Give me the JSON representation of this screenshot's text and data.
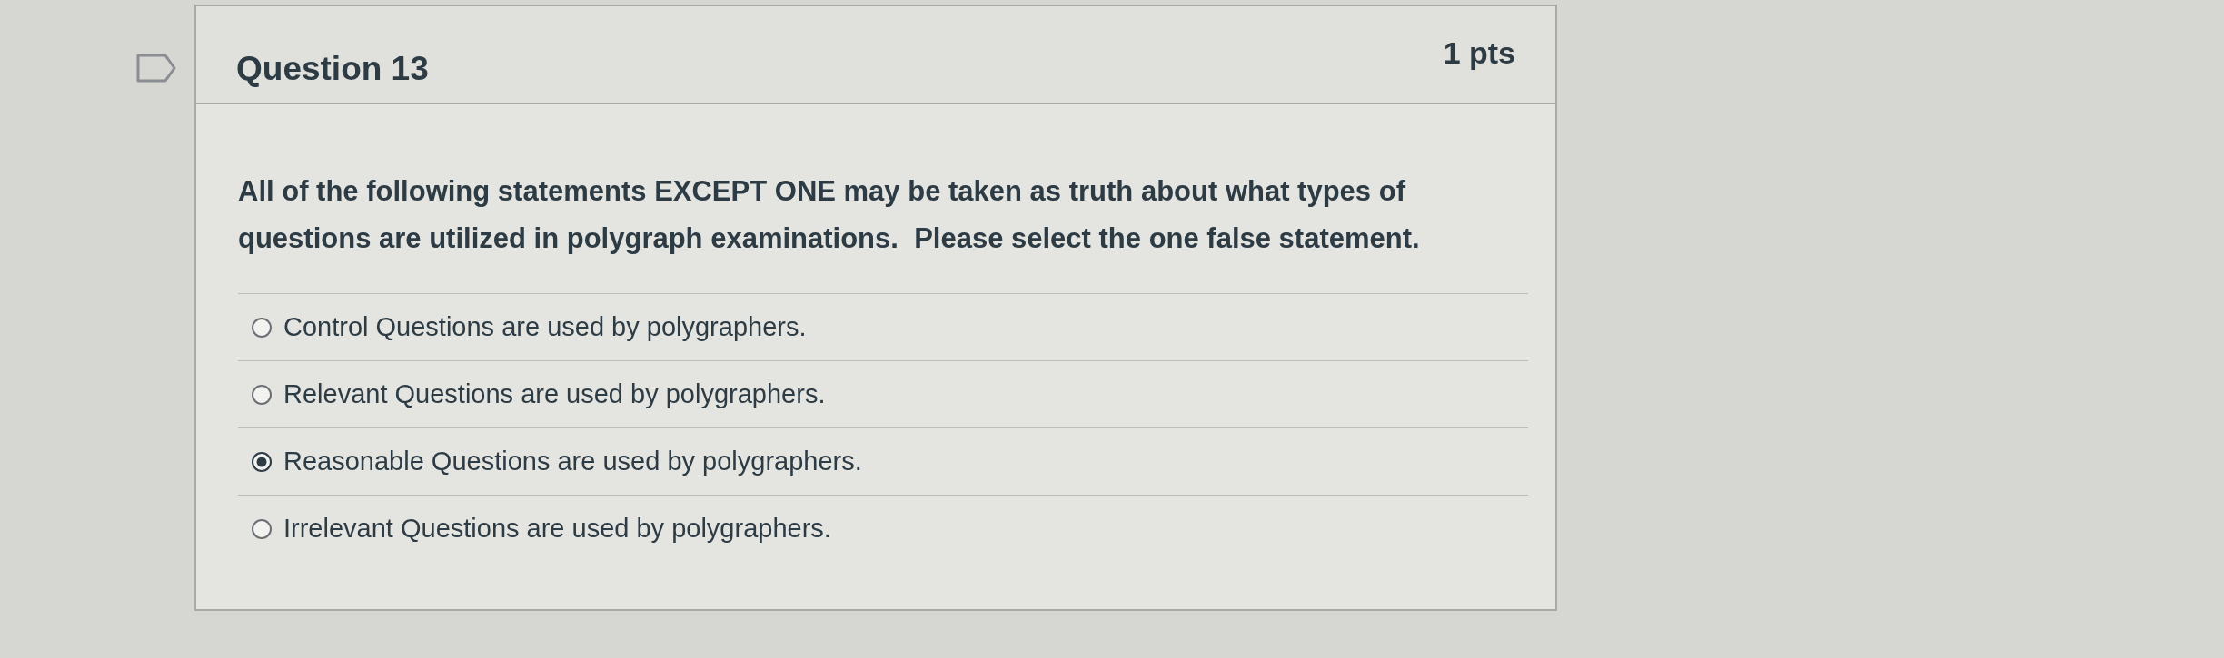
{
  "question": {
    "title": "Question 13",
    "points": "1 pts",
    "text": "All of the following statements EXCEPT ONE may be taken as truth about what types of questions are utilized in polygraph examinations.  Please select the one false statement.",
    "answers": [
      {
        "label": "Control Questions are used by polygraphers.",
        "selected": false
      },
      {
        "label": "Relevant Questions are used by polygraphers.",
        "selected": false
      },
      {
        "label": "Reasonable Questions are used by polygraphers.",
        "selected": true
      },
      {
        "label": "Irrelevant Questions are used by polygraphers.",
        "selected": false
      }
    ]
  }
}
